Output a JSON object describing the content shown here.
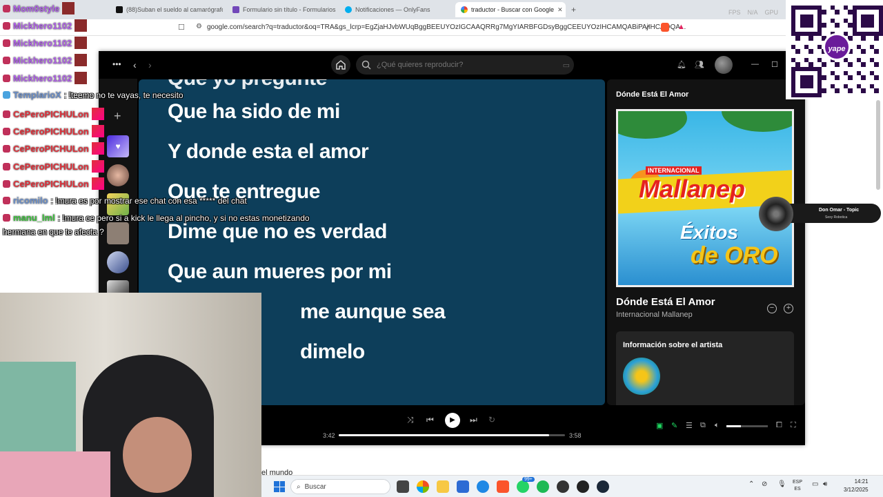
{
  "browser": {
    "tabs": [
      {
        "label": "(88)Suban el sueldo al camarógrafo",
        "icon": "tiktok-icon"
      },
      {
        "label": "Formulario sin título - Formularios de",
        "icon": "forms-icon"
      },
      {
        "label": "Notificaciones — OnlyFans",
        "icon": "onlyfans-icon"
      },
      {
        "label": "traductor - Buscar con Google",
        "icon": "google-icon",
        "active": true
      }
    ],
    "new_tab": "+",
    "url": "google.com/search?q=traductor&oq=TRA&gs_lcrp=EgZjaHJvbWUqBggBEEUYOzIGCAAQRRg7MgYIARBFGDsyBggCEEUYOzIHCAMQABiPAjIHCAQQA...",
    "stats": [
      "FPS",
      "N/A",
      "GPU"
    ]
  },
  "spotify": {
    "search_placeholder": "¿Qué quieres reproducir?",
    "lyrics": [
      "Que ha sido de mi",
      "Y donde esta el amor",
      "Que te entregue",
      "Dime que no es verdad",
      "Que aun mueres por mi",
      "me aunque sea",
      "dimelo"
    ],
    "now_playing": {
      "panel_title": "Dónde Está El Amor",
      "song": "Dónde Está El Amor",
      "artist": "Internacional Mallanep",
      "about_label": "Información sobre el artista",
      "cover": {
        "top_label": "INTERNACIONAL",
        "brand": "Mallanep",
        "line1": "Éxitos",
        "line2": "de ORO",
        "colors": {
          "sky": "#39b6e6",
          "band": "#f2d11a",
          "brand": "#e5221f",
          "gold": "#f5c518"
        }
      }
    },
    "player": {
      "elapsed": "3:42",
      "duration": "3:58",
      "progress": 0.93,
      "volume": 0.35
    }
  },
  "chat": [
    {
      "user": "Mom0style",
      "msg": "",
      "color": "#b060e8"
    },
    {
      "user": "Mickhero1102",
      "msg": "",
      "color": "#b060e8"
    },
    {
      "user": "Mickhero1102",
      "msg": "",
      "color": "#b060e8"
    },
    {
      "user": "Mickhero1102",
      "msg": "",
      "color": "#b060e8"
    },
    {
      "user": "Mickhero1102",
      "msg": "",
      "color": "#b060e8"
    },
    {
      "user": "TemplarioX",
      "msg": ": !teemo no te vayas, te necesito",
      "color": "#6a8ec8"
    },
    {
      "user": "CePeroPICHULon",
      "msg": "",
      "color": "#e0303a"
    },
    {
      "user": "CePeroPICHULon",
      "msg": "",
      "color": "#e0303a"
    },
    {
      "user": "CePeroPICHULon",
      "msg": "",
      "color": "#e0303a"
    },
    {
      "user": "CePeroPICHULon",
      "msg": "",
      "color": "#e0303a"
    },
    {
      "user": "CePeroPICHULon",
      "msg": "",
      "color": "#e0303a"
    },
    {
      "user": "ricomilo",
      "msg": ": !mura es por mostrar ese chat con esa ***** del chat",
      "color": "#6a8ec8"
    },
    {
      "user": "manu_lml",
      "msg": ": !mura ce pero si a kick le llega al pincho, y si no estas monetizando",
      "color": "#3cbf3c"
    },
    {
      "user": "",
      "msg": "hermana en que te afecta ?",
      "color": "#ffffff"
    }
  ],
  "qr": {
    "logo": "yape"
  },
  "youtube_pill": {
    "title": "Don Omar - Topic",
    "subtitle": "Sexy Robotica"
  },
  "page_underlay": "el mundo",
  "taskbar": {
    "search_placeholder": "Buscar",
    "badge": "99+",
    "lang": "ESP",
    "lang_sub": "ES",
    "time": "14:21",
    "date": "3/12/2025"
  }
}
